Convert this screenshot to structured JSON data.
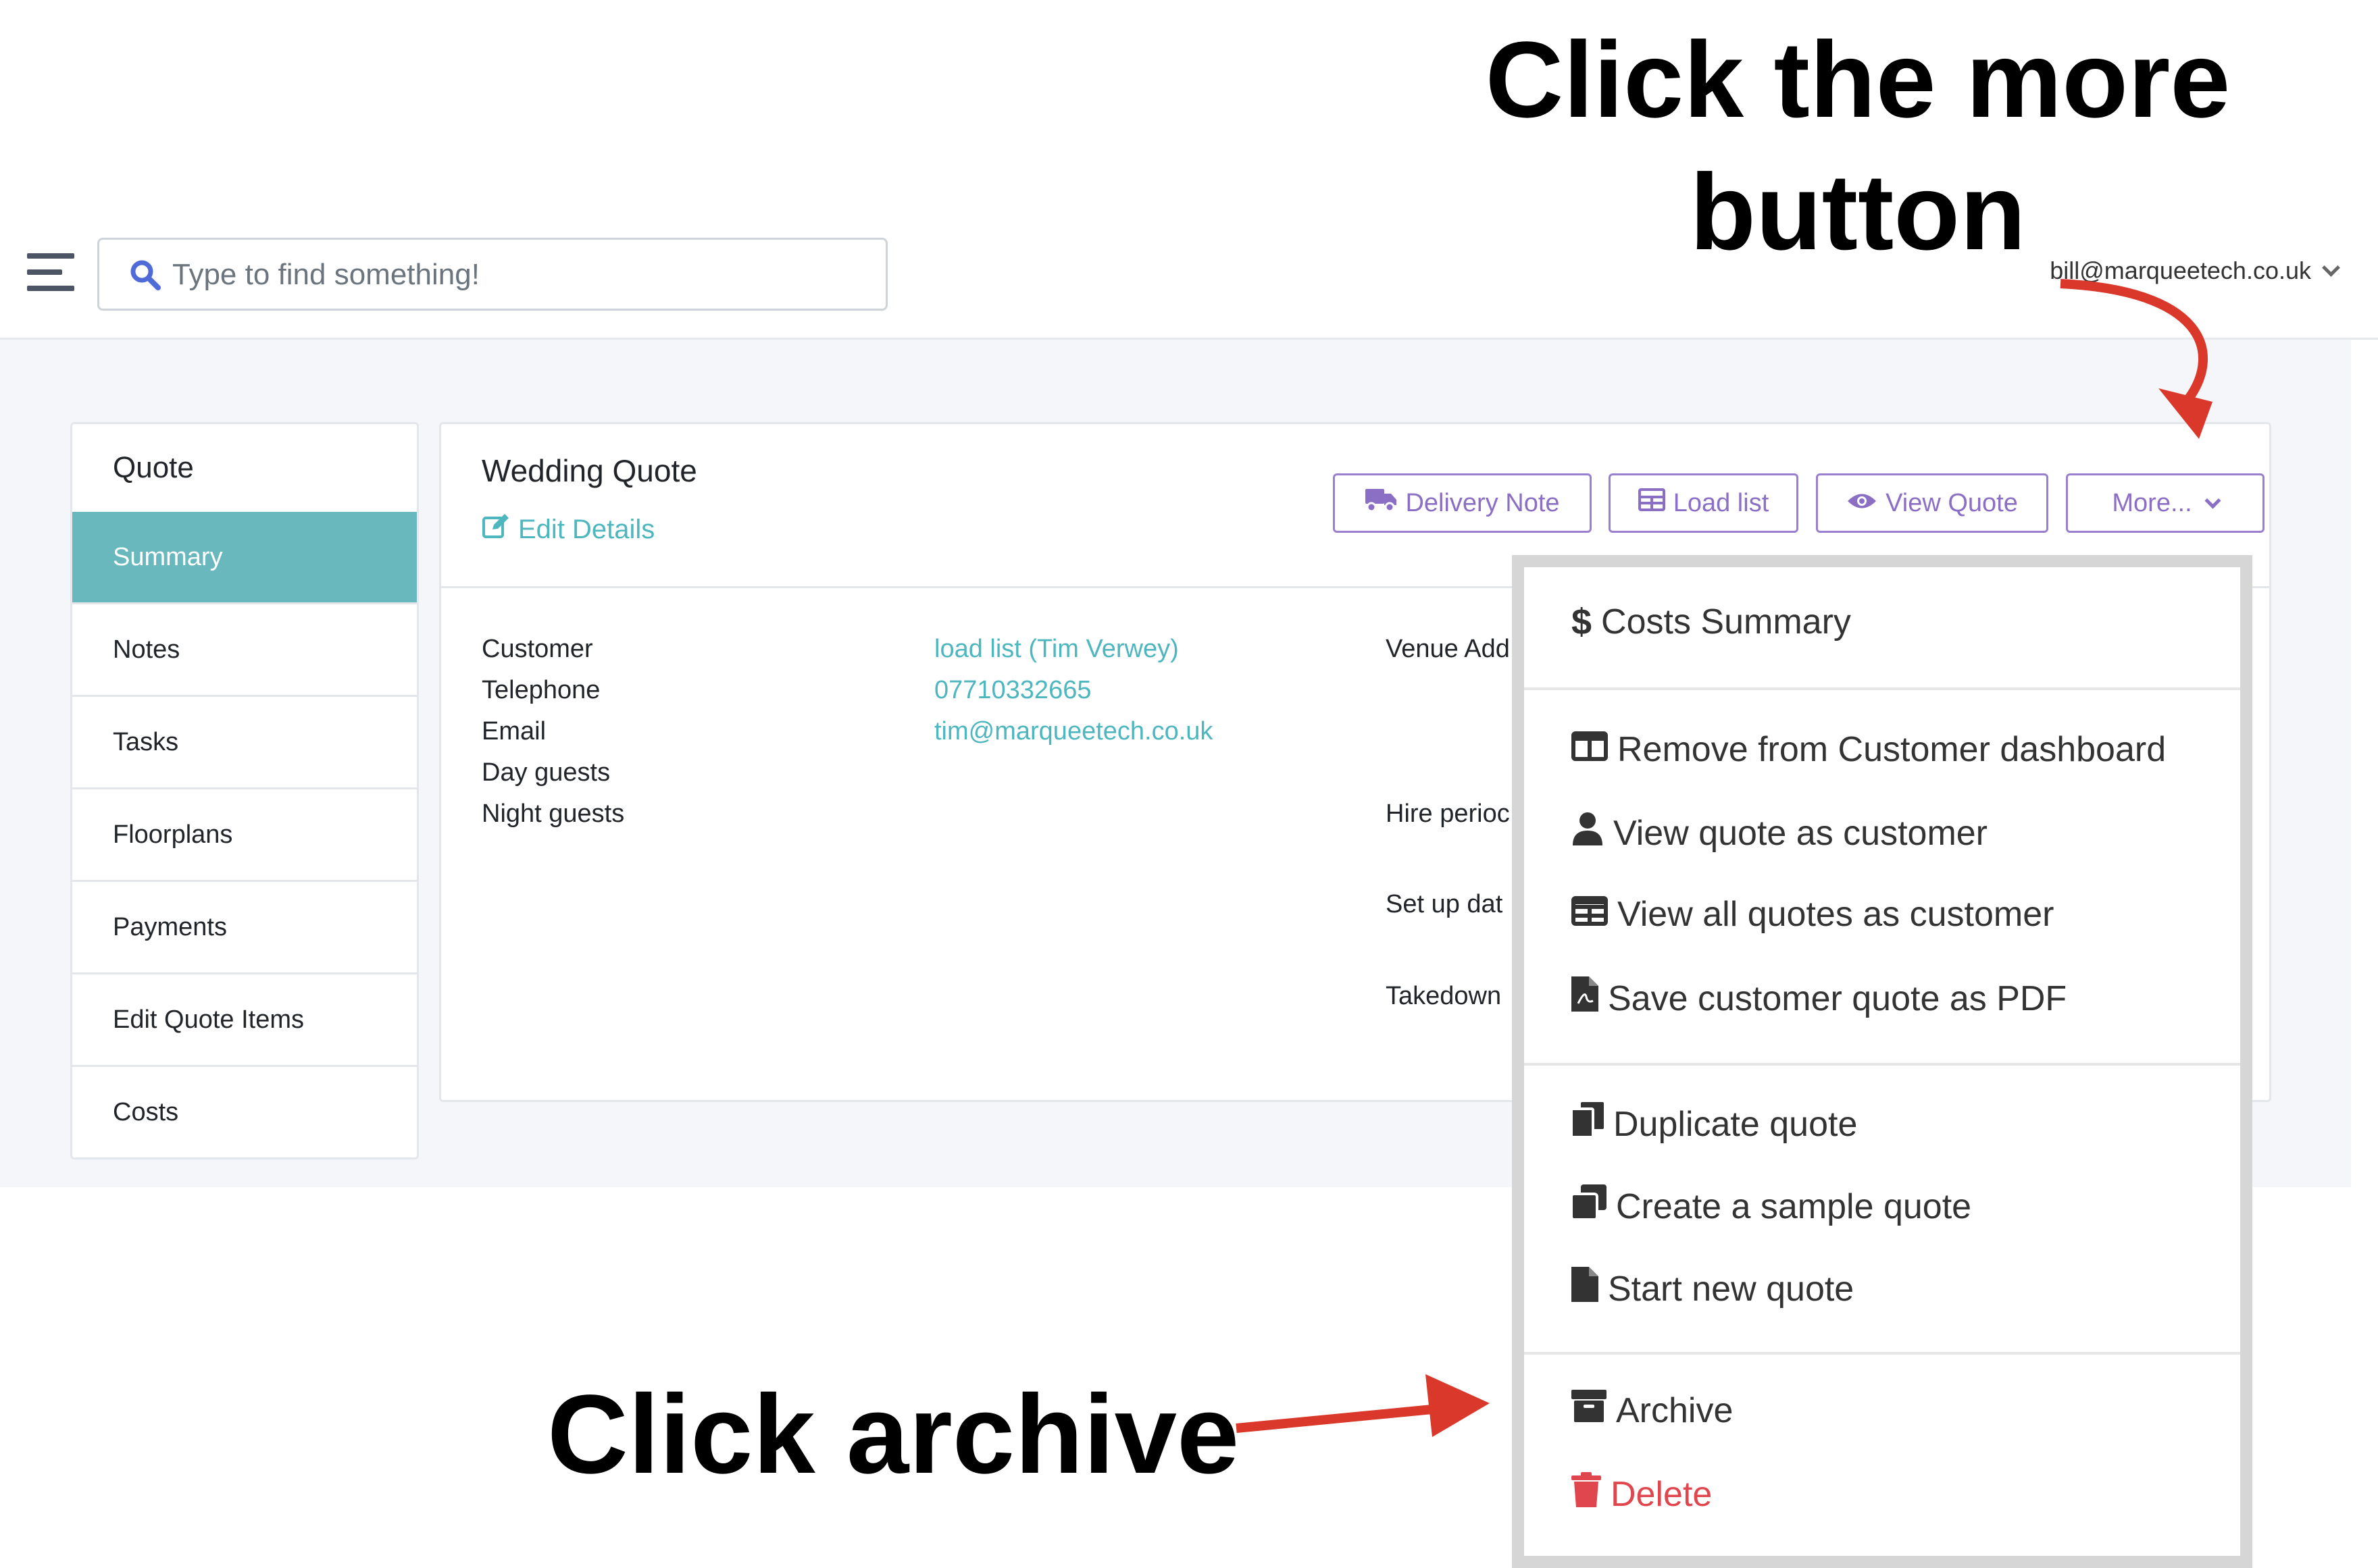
{
  "search": {
    "placeholder": "Type to find something!"
  },
  "user": {
    "email": "bill@marqueetech.co.uk"
  },
  "sidebar": {
    "title": "Quote",
    "items": [
      {
        "label": "Summary",
        "active": true
      },
      {
        "label": "Notes"
      },
      {
        "label": "Tasks"
      },
      {
        "label": "Floorplans"
      },
      {
        "label": "Payments"
      },
      {
        "label": "Edit Quote Items"
      },
      {
        "label": "Costs"
      }
    ]
  },
  "quote": {
    "title": "Wedding Quote",
    "edit_label": "Edit Details",
    "buttons": {
      "delivery": "Delivery Note",
      "load": "Load list",
      "view": "View Quote",
      "more": "More..."
    },
    "fields": [
      {
        "label": "Customer",
        "value": "load list (Tim Verwey)"
      },
      {
        "label": "Telephone",
        "value": "07710332665"
      },
      {
        "label": "Email",
        "value": "tim@marqueetech.co.uk"
      },
      {
        "label": "Day guests",
        "value": ""
      },
      {
        "label": "Night guests",
        "value": ""
      }
    ],
    "right_fields": [
      "Venue Add",
      "Hire perioc",
      "Set up dat",
      "Takedown"
    ]
  },
  "dropdown": {
    "items": [
      {
        "label": "Costs Summary",
        "icon": "dollar-icon"
      },
      {
        "label": "Remove from Customer dashboard",
        "icon": "columns-icon"
      },
      {
        "label": "View quote as customer",
        "icon": "user-icon"
      },
      {
        "label": "View all quotes as customer",
        "icon": "table-icon"
      },
      {
        "label": "Save customer quote as PDF",
        "icon": "pdf-file-icon"
      },
      {
        "label": "Duplicate quote",
        "icon": "copy-icon"
      },
      {
        "label": "Create a sample quote",
        "icon": "clone-icon"
      },
      {
        "label": "Start new quote",
        "icon": "file-icon"
      },
      {
        "label": "Archive",
        "icon": "archive-icon"
      },
      {
        "label": "Delete",
        "icon": "trash-icon"
      }
    ]
  },
  "annotations": {
    "more": "Click the more button",
    "archive": "Click archive"
  },
  "colors": {
    "teal": "#68b8bd",
    "link": "#4db6bf",
    "purple": "#8a6fc4",
    "danger": "#e0464e",
    "arrow": "#d9382a"
  }
}
